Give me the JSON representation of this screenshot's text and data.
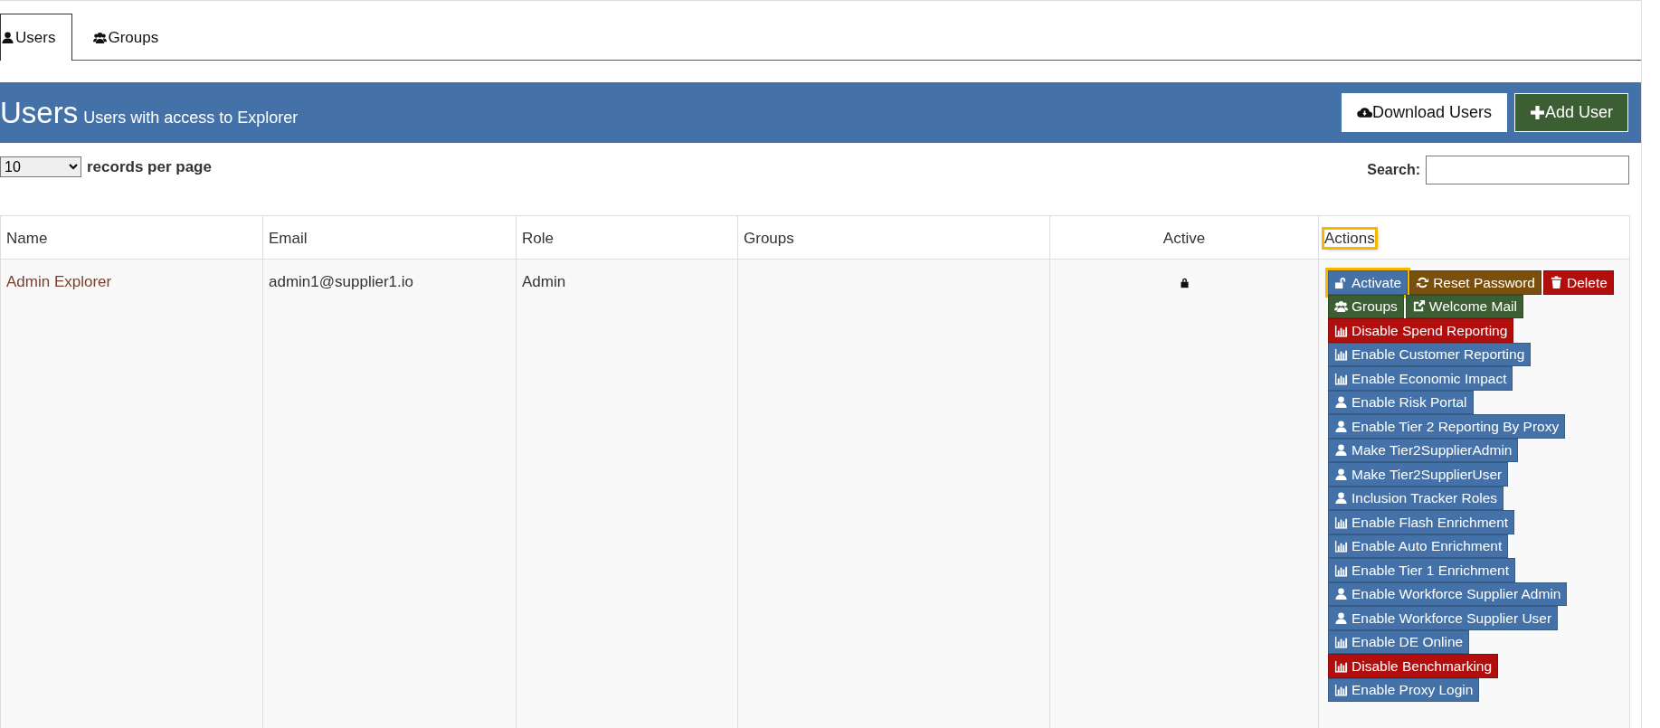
{
  "tabs": [
    {
      "label": "Users",
      "selected": true
    },
    {
      "label": "Groups",
      "selected": false
    }
  ],
  "header": {
    "title": "Users",
    "subtitle": "Users with access to Explorer",
    "buttons": [
      {
        "label": "Download Users",
        "color": "#ffffff"
      },
      {
        "label": "Add User",
        "color": "#3c5e33"
      }
    ]
  },
  "page_size": {
    "value": "10",
    "label": "records per page"
  },
  "search": {
    "label": "Search:"
  },
  "table": {
    "columns": [
      {
        "label": "Name",
        "highlighted": false
      },
      {
        "label": "Email",
        "highlighted": false
      },
      {
        "label": "Role",
        "highlighted": false
      },
      {
        "label": "Groups",
        "highlighted": false
      },
      {
        "label": "Active",
        "highlighted": false
      },
      {
        "label": "Actions",
        "highlighted": true
      }
    ],
    "rows": [
      {
        "name": "Admin Explorer",
        "email": "admin1@supplier1.io",
        "role": "Admin",
        "active": false,
        "action_rows": [
          [
            {
              "label": "Activate",
              "color": "#4472a8",
              "highlighted": true
            },
            {
              "label": "Reset Password",
              "color": "#7a4f0c",
              "highlighted": false
            },
            {
              "label": "Delete",
              "color": "#b20e0e",
              "highlighted": false
            }
          ],
          [
            {
              "label": "Groups",
              "color": "#3c5e33",
              "highlighted": false
            },
            {
              "label": "Welcome Mail",
              "color": "#3c5e33",
              "highlighted": false
            }
          ],
          [
            {
              "label": "Disable Spend Reporting",
              "color": "#b20e0e",
              "highlighted": false
            }
          ],
          [
            {
              "label": "Enable Customer Reporting",
              "color": "#4472a8",
              "highlighted": false
            }
          ],
          [
            {
              "label": "Enable Economic Impact",
              "color": "#4472a8",
              "highlighted": false
            }
          ],
          [
            {
              "label": "Enable Risk Portal",
              "color": "#4472a8",
              "highlighted": false
            }
          ],
          [
            {
              "label": "Enable Tier 2 Reporting By Proxy",
              "color": "#4472a8",
              "highlighted": false
            }
          ],
          [
            {
              "label": "Make Tier2SupplierAdmin",
              "color": "#4472a8",
              "highlighted": false
            }
          ],
          [
            {
              "label": "Make Tier2SupplierUser",
              "color": "#4472a8",
              "highlighted": false
            }
          ],
          [
            {
              "label": "Inclusion Tracker Roles",
              "color": "#4472a8",
              "highlighted": false
            }
          ],
          [
            {
              "label": "Enable Flash Enrichment",
              "color": "#4472a8",
              "highlighted": false
            }
          ],
          [
            {
              "label": "Enable Auto Enrichment",
              "color": "#4472a8",
              "highlighted": false
            }
          ],
          [
            {
              "label": "Enable Tier 1 Enrichment",
              "color": "#4472a8",
              "highlighted": false
            }
          ],
          [
            {
              "label": "Enable Workforce Supplier Admin",
              "color": "#4472a8",
              "highlighted": false
            }
          ],
          [
            {
              "label": "Enable Workforce Supplier User",
              "color": "#4472a8",
              "highlighted": false
            }
          ],
          [
            {
              "label": "Enable DE Online",
              "color": "#4472a8",
              "highlighted": false
            }
          ],
          [
            {
              "label": "Disable Benchmarking",
              "color": "#b20e0e",
              "highlighted": false
            }
          ],
          [
            {
              "label": "Enable Proxy Login",
              "color": "#4472a8",
              "highlighted": false
            }
          ]
        ]
      }
    ]
  }
}
